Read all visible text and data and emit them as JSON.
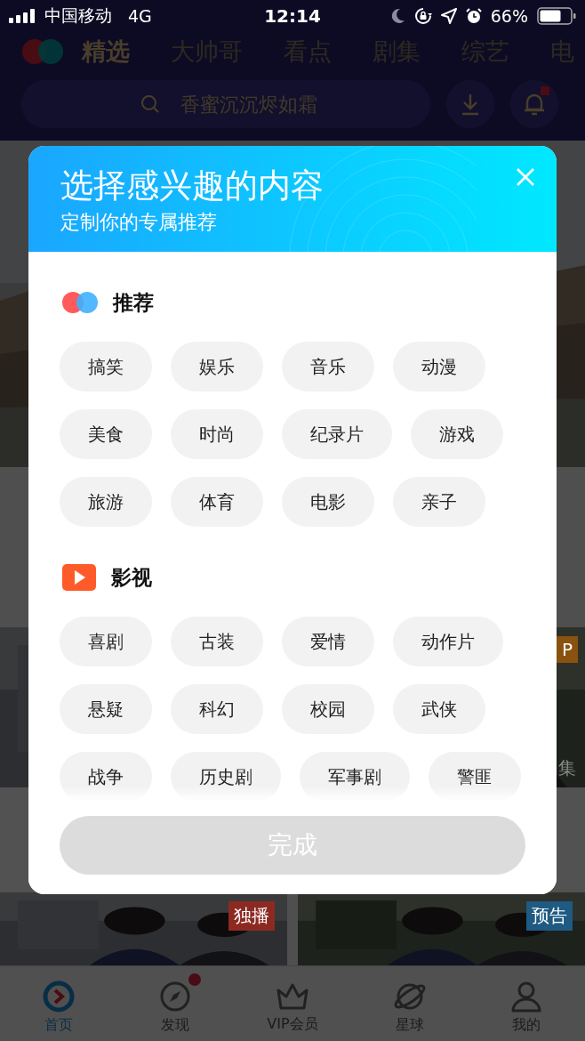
{
  "status_bar": {
    "carrier": "中国移动",
    "network": "4G",
    "time": "12:14",
    "battery": "66%"
  },
  "nav_tabs": [
    {
      "label": "精选",
      "selected": true
    },
    {
      "label": "大帅哥",
      "selected": false
    },
    {
      "label": "看点",
      "selected": false
    },
    {
      "label": "剧集",
      "selected": false
    },
    {
      "label": "综艺",
      "selected": false
    },
    {
      "label": "电",
      "selected": false
    }
  ],
  "search": {
    "placeholder": "香蜜沉沉烬如霜"
  },
  "bell_badge": true,
  "feed_rows": [
    {
      "cards": [
        {
          "kind": "picture"
        },
        {
          "kind": "picture",
          "badge": {
            "text": "P",
            "color": "#8a5210"
          },
          "caption": "集"
        }
      ]
    },
    {
      "cards": [
        {
          "kind": "picture",
          "badge": {
            "text": "独播",
            "color": "#8c2a22"
          }
        },
        {
          "kind": "picture",
          "badge": {
            "text": "预告",
            "color": "#1e5a82"
          }
        }
      ]
    }
  ],
  "modal": {
    "title": "选择感兴趣的内容",
    "subtitle": "定制你的专属推荐",
    "sections": [
      {
        "title": "推荐",
        "kind": "recommend",
        "tags": [
          {
            "label": "搞笑",
            "selected": false
          },
          {
            "label": "娱乐",
            "selected": false
          },
          {
            "label": "音乐",
            "selected": false
          },
          {
            "label": "动漫",
            "selected": false
          },
          {
            "label": "美食",
            "selected": false
          },
          {
            "label": "时尚",
            "selected": false
          },
          {
            "label": "纪录片",
            "selected": false
          },
          {
            "label": "游戏",
            "selected": false
          },
          {
            "label": "旅游",
            "selected": false
          },
          {
            "label": "体育",
            "selected": false
          },
          {
            "label": "电影",
            "selected": false
          },
          {
            "label": "亲子",
            "selected": false
          }
        ]
      },
      {
        "title": "影视",
        "kind": "video",
        "tags": [
          {
            "label": "喜剧",
            "selected": false
          },
          {
            "label": "古装",
            "selected": false
          },
          {
            "label": "爱情",
            "selected": false
          },
          {
            "label": "动作片",
            "selected": false
          },
          {
            "label": "悬疑",
            "selected": false
          },
          {
            "label": "科幻",
            "selected": false
          },
          {
            "label": "校园",
            "selected": false
          },
          {
            "label": "武侠",
            "selected": false
          },
          {
            "label": "战争",
            "selected": false
          },
          {
            "label": "历史剧",
            "selected": false
          },
          {
            "label": "军事剧",
            "selected": false
          },
          {
            "label": "警匪",
            "selected": false
          }
        ]
      }
    ],
    "done_button": {
      "label": "完成",
      "disabled": true
    }
  },
  "tab_bar": [
    {
      "label": "首页",
      "kind": "home",
      "selected": true,
      "badge": false
    },
    {
      "label": "发现",
      "kind": "discover",
      "selected": false,
      "badge": true
    },
    {
      "label": "VIP会员",
      "kind": "vip",
      "selected": false,
      "badge": false
    },
    {
      "label": "星球",
      "kind": "planet",
      "selected": false,
      "badge": false
    },
    {
      "label": "我的",
      "kind": "profile",
      "selected": false,
      "badge": false
    }
  ]
}
